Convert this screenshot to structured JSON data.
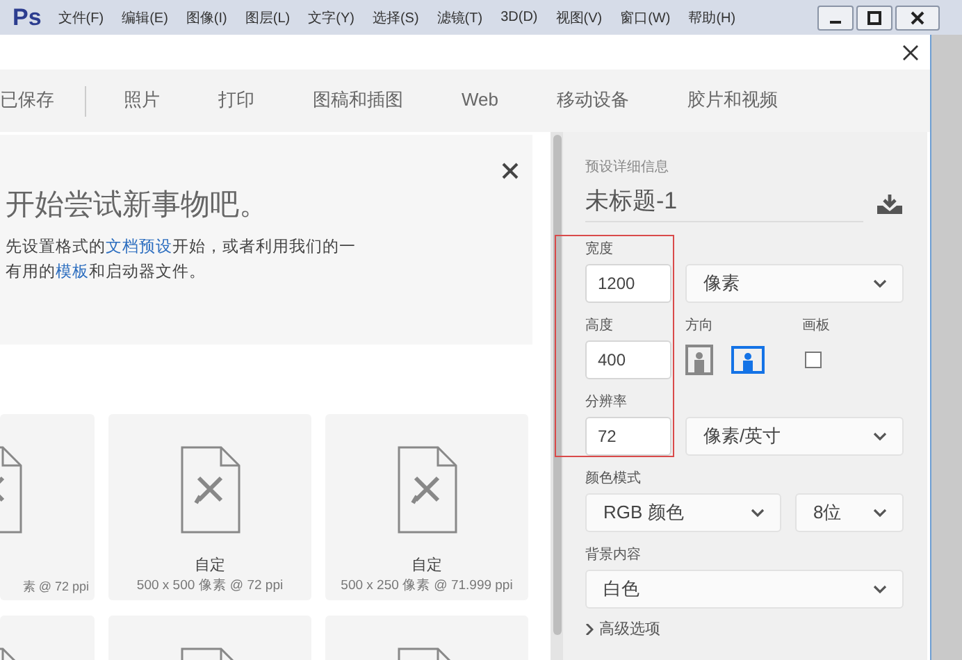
{
  "menubar": {
    "logo": "Ps",
    "items": [
      "文件(F)",
      "编辑(E)",
      "图像(I)",
      "图层(L)",
      "文字(Y)",
      "选择(S)",
      "滤镜(T)",
      "3D(D)",
      "视图(V)",
      "窗口(W)",
      "帮助(H)"
    ]
  },
  "tabs": [
    {
      "label": "已保存",
      "selected": false
    },
    {
      "label": "照片",
      "selected": false
    },
    {
      "label": "打印",
      "selected": false
    },
    {
      "label": "图稿和插图",
      "selected": false
    },
    {
      "label": "Web",
      "selected": false
    },
    {
      "label": "移动设备",
      "selected": false
    },
    {
      "label": "胶片和视频",
      "selected": false
    }
  ],
  "intro": {
    "heading": "开始尝试新事物吧。",
    "lines": [
      [
        {
          "kind": "text",
          "text": "先设置格式的"
        },
        {
          "kind": "link",
          "text": "文档预设"
        },
        {
          "kind": "text",
          "text": "开始，或者利用我们的一"
        }
      ],
      [
        {
          "kind": "text",
          "text": "有用的"
        },
        {
          "kind": "link",
          "text": "模板"
        },
        {
          "kind": "text",
          "text": "和启动器文件。"
        }
      ]
    ]
  },
  "presets": [
    {
      "kind": "cut_left",
      "size": "素 @ 72 ppi"
    },
    {
      "kind": "full",
      "name": "自定",
      "size": "500 x 500 像素 @ 72 ppi"
    },
    {
      "kind": "full",
      "name": "自定",
      "size": "500 x 250 像素 @ 71.999 ppi"
    },
    {
      "kind": "top_only"
    },
    {
      "kind": "top_only"
    },
    {
      "kind": "top_only"
    }
  ],
  "details": {
    "heading": "预设详细信息",
    "doc_name": "未标题-1",
    "width": {
      "label": "宽度",
      "value": "1200"
    },
    "width_unit": "像素",
    "height": {
      "label": "高度",
      "value": "400"
    },
    "orientation": {
      "label": "方向",
      "options": [
        {
          "kind": "portrait",
          "selected": false
        },
        {
          "kind": "landscape",
          "selected": true
        }
      ]
    },
    "artboard": {
      "label": "画板",
      "checked": false
    },
    "resolution": {
      "label": "分辨率",
      "value": "72"
    },
    "resolution_unit": "像素/英寸",
    "color_mode": {
      "label": "颜色模式",
      "mode": "RGB 颜色",
      "depth": "8位"
    },
    "background": {
      "label": "背景内容",
      "value": "白色"
    },
    "advanced": {
      "label": "高级选项",
      "expanded": false
    }
  },
  "highlight_frame": true
}
